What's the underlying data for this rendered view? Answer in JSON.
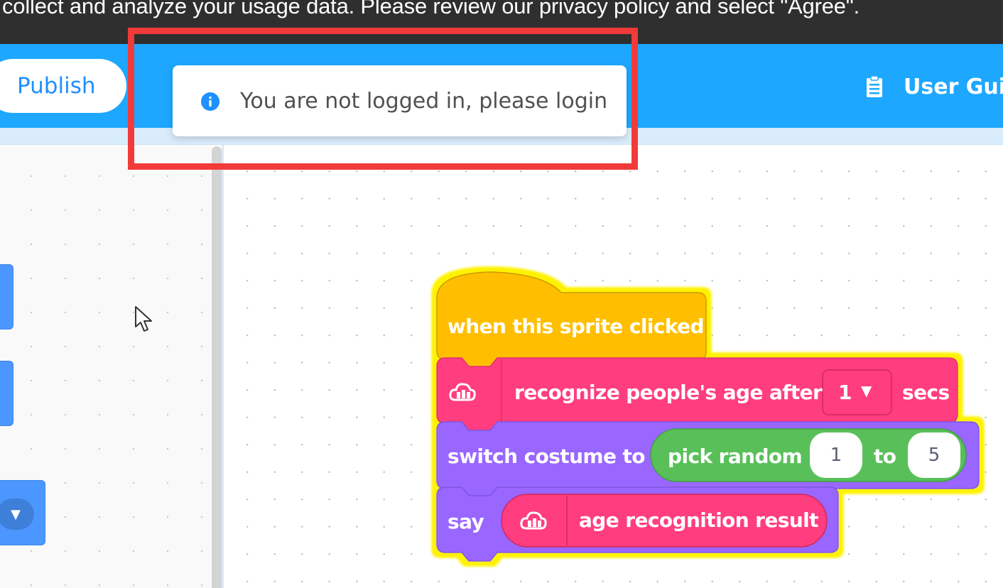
{
  "privacy_banner": {
    "text": "collect and analyze your usage data. Please review our privacy policy and select \"Agree\"."
  },
  "header": {
    "publish_label": "Publish",
    "user_guide_label": "User Guid",
    "bg_color": "#1ea7ff"
  },
  "toast": {
    "icon": "info-icon",
    "message": "You are not logged in, please login",
    "highlight_color": "#f23a3a"
  },
  "script": {
    "hat_label": "when this sprite clicked",
    "recognize_label": "recognize people's age after",
    "recognize_value": "1",
    "recognize_suffix": "secs",
    "switch_label": "switch costume to",
    "random_label": "pick random",
    "random_from": "1",
    "random_to_label": "to",
    "random_to": "5",
    "say_label": "say",
    "reporter_label": "age recognition result",
    "colors": {
      "events": "#ffbf00",
      "ai_extension": "#ff3d7f",
      "looks": "#9966ff",
      "operators": "#59c059",
      "glow": "#fff200"
    }
  }
}
